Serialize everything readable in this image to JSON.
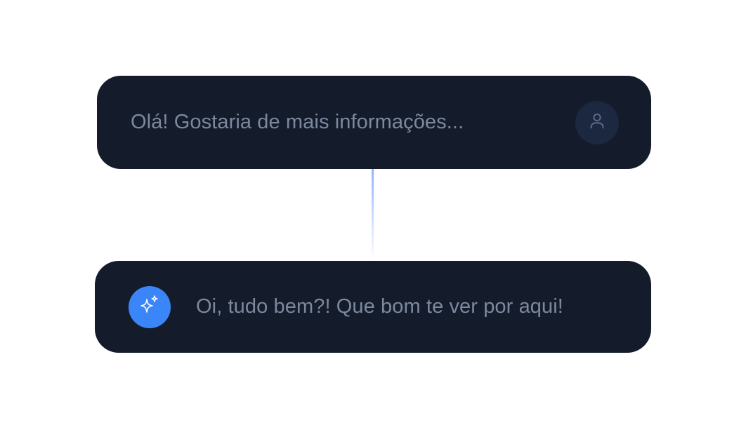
{
  "conversation": {
    "user_message": {
      "text": "Olá! Gostaria de mais informações...",
      "avatar_icon": "user-icon"
    },
    "ai_message": {
      "text": "Oi, tudo bem?! Que bom te ver por aqui!",
      "avatar_icon": "sparkles-icon"
    }
  },
  "colors": {
    "bubble_bg": "#141c2b",
    "text": "#7b889e",
    "ai_accent": "#3a86f8",
    "user_avatar_bg": "#1c2740",
    "connector": "#8fb2ff"
  }
}
